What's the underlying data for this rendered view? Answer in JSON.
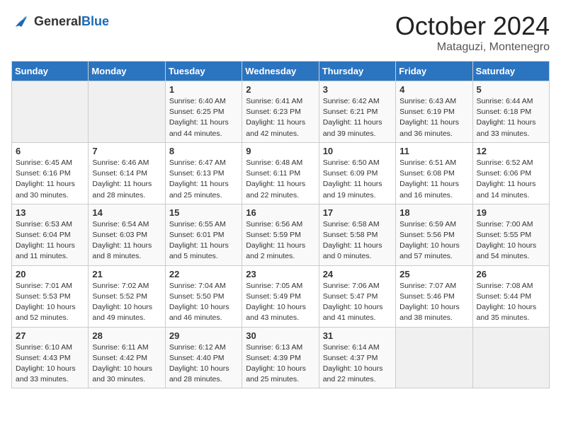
{
  "header": {
    "logo_general": "General",
    "logo_blue": "Blue",
    "month_title": "October 2024",
    "subtitle": "Mataguzi, Montenegro"
  },
  "calendar": {
    "days_of_week": [
      "Sunday",
      "Monday",
      "Tuesday",
      "Wednesday",
      "Thursday",
      "Friday",
      "Saturday"
    ],
    "weeks": [
      [
        {
          "day": "",
          "info": ""
        },
        {
          "day": "",
          "info": ""
        },
        {
          "day": "1",
          "info": "Sunrise: 6:40 AM\nSunset: 6:25 PM\nDaylight: 11 hours and 44 minutes."
        },
        {
          "day": "2",
          "info": "Sunrise: 6:41 AM\nSunset: 6:23 PM\nDaylight: 11 hours and 42 minutes."
        },
        {
          "day": "3",
          "info": "Sunrise: 6:42 AM\nSunset: 6:21 PM\nDaylight: 11 hours and 39 minutes."
        },
        {
          "day": "4",
          "info": "Sunrise: 6:43 AM\nSunset: 6:19 PM\nDaylight: 11 hours and 36 minutes."
        },
        {
          "day": "5",
          "info": "Sunrise: 6:44 AM\nSunset: 6:18 PM\nDaylight: 11 hours and 33 minutes."
        }
      ],
      [
        {
          "day": "6",
          "info": "Sunrise: 6:45 AM\nSunset: 6:16 PM\nDaylight: 11 hours and 30 minutes."
        },
        {
          "day": "7",
          "info": "Sunrise: 6:46 AM\nSunset: 6:14 PM\nDaylight: 11 hours and 28 minutes."
        },
        {
          "day": "8",
          "info": "Sunrise: 6:47 AM\nSunset: 6:13 PM\nDaylight: 11 hours and 25 minutes."
        },
        {
          "day": "9",
          "info": "Sunrise: 6:48 AM\nSunset: 6:11 PM\nDaylight: 11 hours and 22 minutes."
        },
        {
          "day": "10",
          "info": "Sunrise: 6:50 AM\nSunset: 6:09 PM\nDaylight: 11 hours and 19 minutes."
        },
        {
          "day": "11",
          "info": "Sunrise: 6:51 AM\nSunset: 6:08 PM\nDaylight: 11 hours and 16 minutes."
        },
        {
          "day": "12",
          "info": "Sunrise: 6:52 AM\nSunset: 6:06 PM\nDaylight: 11 hours and 14 minutes."
        }
      ],
      [
        {
          "day": "13",
          "info": "Sunrise: 6:53 AM\nSunset: 6:04 PM\nDaylight: 11 hours and 11 minutes."
        },
        {
          "day": "14",
          "info": "Sunrise: 6:54 AM\nSunset: 6:03 PM\nDaylight: 11 hours and 8 minutes."
        },
        {
          "day": "15",
          "info": "Sunrise: 6:55 AM\nSunset: 6:01 PM\nDaylight: 11 hours and 5 minutes."
        },
        {
          "day": "16",
          "info": "Sunrise: 6:56 AM\nSunset: 5:59 PM\nDaylight: 11 hours and 2 minutes."
        },
        {
          "day": "17",
          "info": "Sunrise: 6:58 AM\nSunset: 5:58 PM\nDaylight: 11 hours and 0 minutes."
        },
        {
          "day": "18",
          "info": "Sunrise: 6:59 AM\nSunset: 5:56 PM\nDaylight: 10 hours and 57 minutes."
        },
        {
          "day": "19",
          "info": "Sunrise: 7:00 AM\nSunset: 5:55 PM\nDaylight: 10 hours and 54 minutes."
        }
      ],
      [
        {
          "day": "20",
          "info": "Sunrise: 7:01 AM\nSunset: 5:53 PM\nDaylight: 10 hours and 52 minutes."
        },
        {
          "day": "21",
          "info": "Sunrise: 7:02 AM\nSunset: 5:52 PM\nDaylight: 10 hours and 49 minutes."
        },
        {
          "day": "22",
          "info": "Sunrise: 7:04 AM\nSunset: 5:50 PM\nDaylight: 10 hours and 46 minutes."
        },
        {
          "day": "23",
          "info": "Sunrise: 7:05 AM\nSunset: 5:49 PM\nDaylight: 10 hours and 43 minutes."
        },
        {
          "day": "24",
          "info": "Sunrise: 7:06 AM\nSunset: 5:47 PM\nDaylight: 10 hours and 41 minutes."
        },
        {
          "day": "25",
          "info": "Sunrise: 7:07 AM\nSunset: 5:46 PM\nDaylight: 10 hours and 38 minutes."
        },
        {
          "day": "26",
          "info": "Sunrise: 7:08 AM\nSunset: 5:44 PM\nDaylight: 10 hours and 35 minutes."
        }
      ],
      [
        {
          "day": "27",
          "info": "Sunrise: 6:10 AM\nSunset: 4:43 PM\nDaylight: 10 hours and 33 minutes."
        },
        {
          "day": "28",
          "info": "Sunrise: 6:11 AM\nSunset: 4:42 PM\nDaylight: 10 hours and 30 minutes."
        },
        {
          "day": "29",
          "info": "Sunrise: 6:12 AM\nSunset: 4:40 PM\nDaylight: 10 hours and 28 minutes."
        },
        {
          "day": "30",
          "info": "Sunrise: 6:13 AM\nSunset: 4:39 PM\nDaylight: 10 hours and 25 minutes."
        },
        {
          "day": "31",
          "info": "Sunrise: 6:14 AM\nSunset: 4:37 PM\nDaylight: 10 hours and 22 minutes."
        },
        {
          "day": "",
          "info": ""
        },
        {
          "day": "",
          "info": ""
        }
      ]
    ]
  }
}
